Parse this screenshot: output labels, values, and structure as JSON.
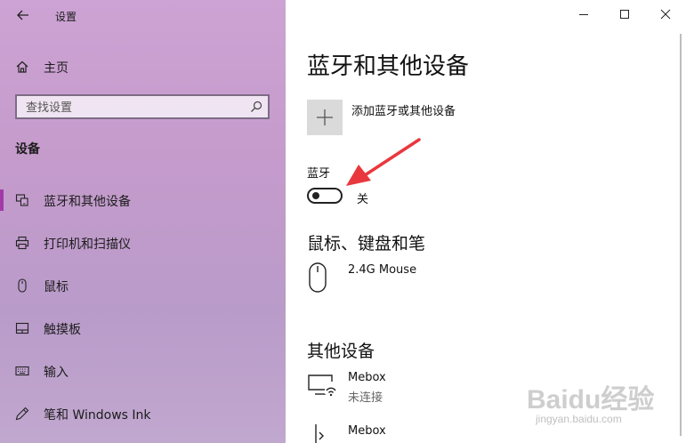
{
  "window": {
    "app_title": "设置"
  },
  "sidebar": {
    "home_label": "主页",
    "search_placeholder": "查找设置",
    "section_title": "设备",
    "items": [
      {
        "label": "蓝牙和其他设备",
        "icon": "bluetooth-devices-icon",
        "active": true
      },
      {
        "label": "打印机和扫描仪",
        "icon": "printer-icon",
        "active": false
      },
      {
        "label": "鼠标",
        "icon": "mouse-icon",
        "active": false
      },
      {
        "label": "触摸板",
        "icon": "touchpad-icon",
        "active": false
      },
      {
        "label": "输入",
        "icon": "keyboard-icon",
        "active": false
      },
      {
        "label": "笔和 Windows Ink",
        "icon": "pen-icon",
        "active": false
      }
    ],
    "accent_color": "#a13aa8"
  },
  "main": {
    "title": "蓝牙和其他设备",
    "add_device_label": "添加蓝牙或其他设备",
    "bluetooth": {
      "label": "蓝牙",
      "state_label": "关",
      "on": false
    },
    "mouse_section": {
      "title": "鼠标、键盘和笔",
      "devices": [
        {
          "name": "2.4G Mouse",
          "icon": "mouse-icon"
        }
      ]
    },
    "other_section": {
      "title": "其他设备",
      "devices": [
        {
          "name": "Mebox",
          "status": "未连接",
          "icon": "network-display-icon"
        },
        {
          "name": "Mebox",
          "icon": "phone-device-icon"
        }
      ]
    }
  },
  "annotation": {
    "arrow_color": "#e8383d"
  },
  "watermark": {
    "brand": "Baidu经验",
    "url": "jingyan.baidu.com"
  }
}
